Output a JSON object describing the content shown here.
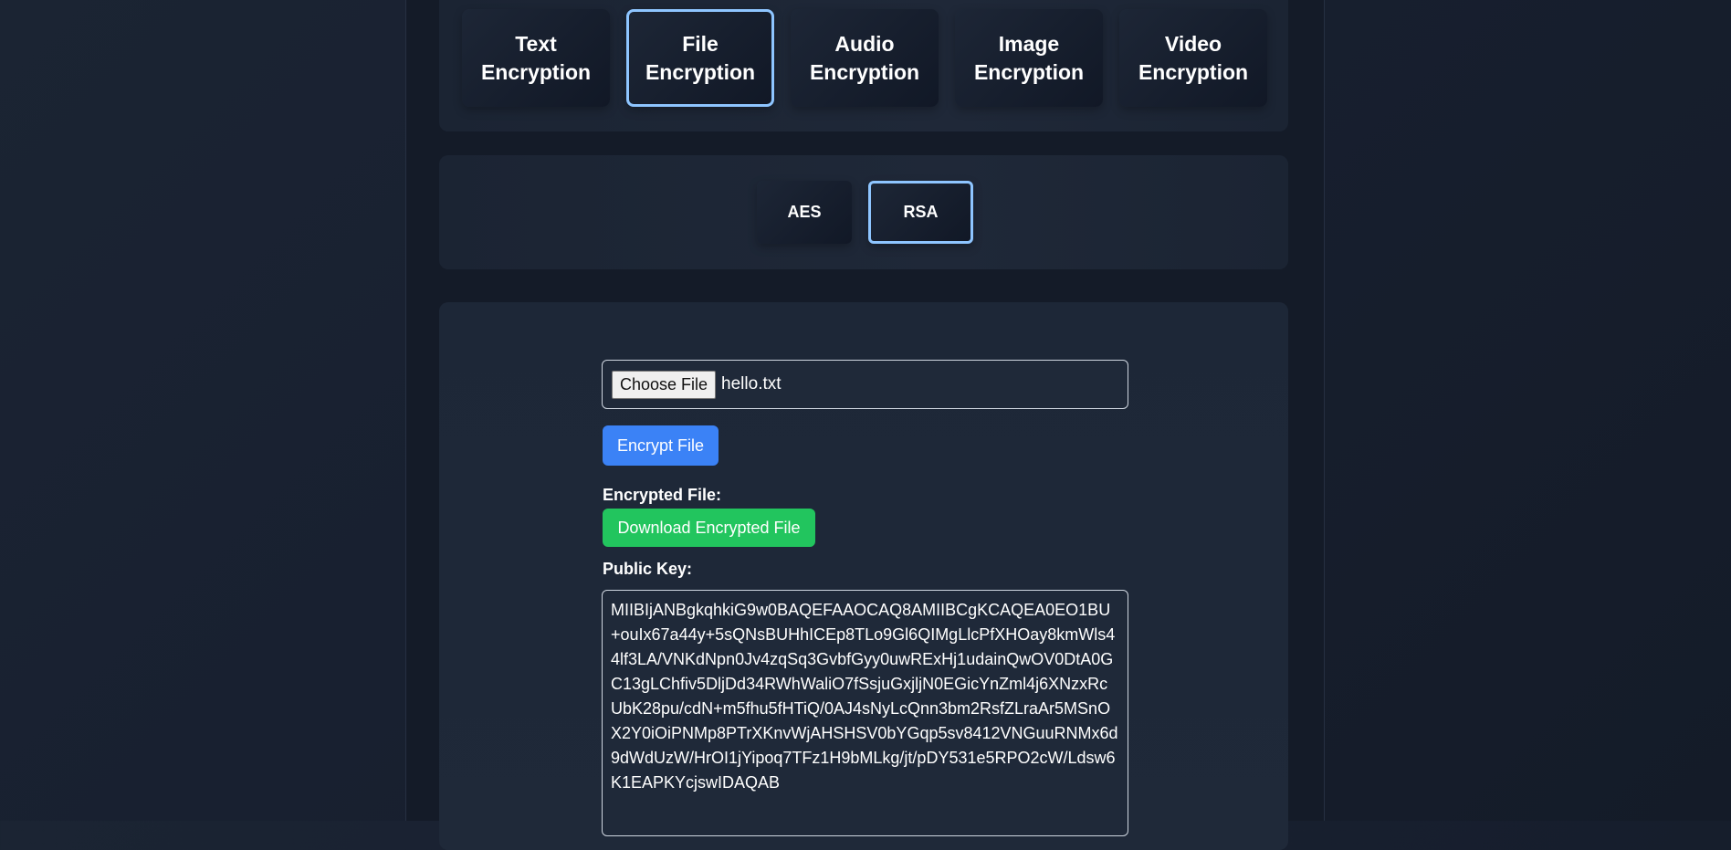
{
  "category_tabs": [
    {
      "label": "Text\nEncryption",
      "active": false
    },
    {
      "label": "File\nEncryption",
      "active": true
    },
    {
      "label": "Audio\nEncryption",
      "active": false
    },
    {
      "label": "Image\nEncryption",
      "active": false
    },
    {
      "label": "Video\nEncryption",
      "active": false
    }
  ],
  "algorithms": [
    {
      "label": "AES",
      "active": false
    },
    {
      "label": "RSA",
      "active": true
    }
  ],
  "file_input": {
    "button_label": "Choose File",
    "file_name": "hello.txt"
  },
  "encrypt_button": "Encrypt File",
  "encrypted_file_label": "Encrypted File:",
  "download_button": "Download Encrypted File",
  "public_key_label": "Public Key:",
  "public_key": "MIIBIjANBgkqhkiG9w0BAQEFAAOCAQ8AMIIBCgKCAQEA0EO1BU+ouIx67a44y+5sQNsBUHhICEp8TLo9Gl6QIMgLlcPfXHOay8kmWls44lf3LA/VNKdNpn0Jv4zqSq3GvbfGyy0uwRExHj1udainQwOV0DtA0GC13gLChfiv5DljDd34RWhWaliO7fSsjuGxjljN0EGicYnZml4j6XNzxRcUbK28pu/cdN+m5fhu5fHTiQ/0AJ4sNyLcQnn3bm2RsfZLraAr5MSnOX2Y0iOiPNMp8PTrXKnvWjAHSHSV0bYGqp5sv8412VNGuuRNMx6d9dWdUzW/HrOI1jYipoq7TFz1H9bMLkg/jt/pDY531e5RPO2cW/Ldsw6K1EAPKYcjswIDAQAB",
  "colors": {
    "active_border": "#8ec5ff",
    "encrypt_button": "#3b82f6",
    "download_button": "#22c55e"
  }
}
